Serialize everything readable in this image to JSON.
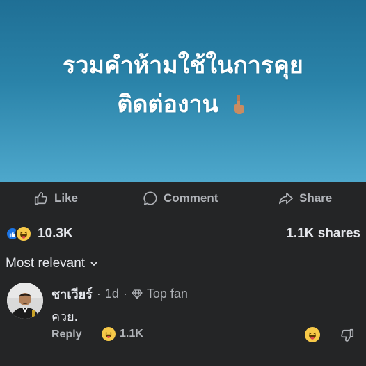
{
  "post": {
    "image_text_line1": "รวมคำห้ามใช้ในการคุย",
    "image_text_line2": "ติดต่องาน",
    "image_emoji_icon": "backhand-index-pointing-down-icon",
    "colors": {
      "image_top": "#1f6f95",
      "image_bottom": "#4ea8cc"
    }
  },
  "actions": {
    "like_label": "Like",
    "comment_label": "Comment",
    "share_label": "Share"
  },
  "stats": {
    "reaction_count": "10.3K",
    "shares": "1.1K shares"
  },
  "sort": {
    "label": "Most relevant"
  },
  "comment": {
    "author": "ชาเวียร์",
    "separator": "·",
    "time": "1d",
    "badge": "Top fan",
    "text": "ควย.",
    "reply_label": "Reply",
    "reaction_count": "1.1K"
  },
  "colors": {
    "background": "#242526",
    "text_primary": "#e4e6eb",
    "text_secondary": "#b0b3b8",
    "like_blue": "#1b74e4",
    "haha_yellow": "#f7c948"
  }
}
